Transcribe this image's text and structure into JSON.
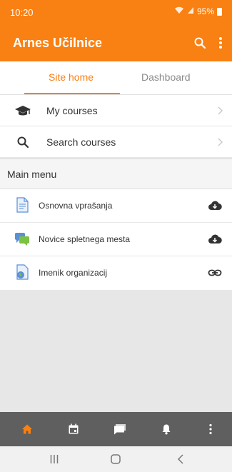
{
  "status": {
    "time": "10:20",
    "battery": "95%",
    "battery_level": 0.95
  },
  "appbar": {
    "title": "Arnes Učilnice",
    "search_icon": "search-icon",
    "more_icon": "more-vert-icon"
  },
  "tabs": [
    {
      "label": "Site home",
      "active": true
    },
    {
      "label": "Dashboard",
      "active": false
    }
  ],
  "list": [
    {
      "label": "My courses",
      "icon": "graduation-cap-icon"
    },
    {
      "label": "Search courses",
      "icon": "search-icon"
    }
  ],
  "section": {
    "label": "Main menu"
  },
  "menu": [
    {
      "label": "Osnovna vprašanja",
      "icon": "document-icon",
      "action_icon": "cloud-download-icon"
    },
    {
      "label": "Novice spletnega mesta",
      "icon": "forum-icon",
      "action_icon": "cloud-download-icon"
    },
    {
      "label": "Imenik organizacij",
      "icon": "url-globe-icon",
      "action_icon": "link-icon"
    }
  ],
  "bottom_nav": [
    "home-icon",
    "calendar-icon",
    "messages-icon",
    "notifications-icon",
    "more-vert-icon"
  ],
  "colors": {
    "accent": "#f98012",
    "bottom_nav_bg": "#5f5f5f",
    "active_icon": "#f98012",
    "inactive_icon": "#ffffff"
  }
}
